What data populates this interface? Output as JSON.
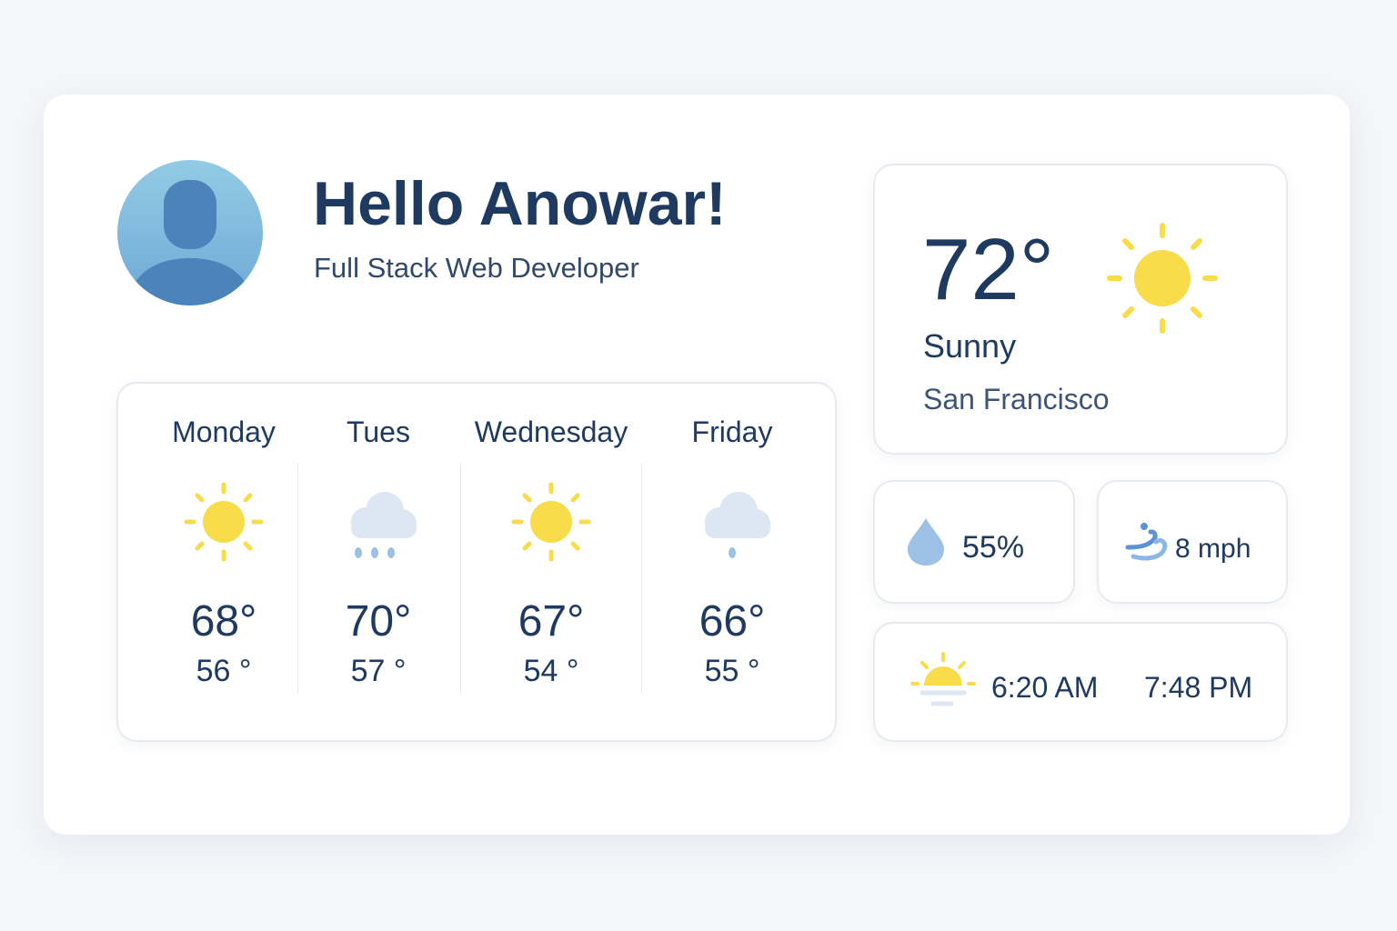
{
  "profile": {
    "greeting": "Hello Anowar!",
    "subtitle": "Full Stack Web Developer",
    "avatar_icon": "user-avatar-icon"
  },
  "current": {
    "temperature": "72°",
    "condition": "Sunny",
    "location": "San Francisco",
    "icon": "sun-icon"
  },
  "forecast": [
    {
      "day": "Monday",
      "icon": "sun-icon",
      "high": "68°",
      "low": "56 °"
    },
    {
      "day": "Tues",
      "icon": "rain-cloud-icon",
      "high": "70°",
      "low": "57 °"
    },
    {
      "day": "Wednesday",
      "icon": "sun-icon",
      "high": "67°",
      "low": "54 °"
    },
    {
      "day": "Friday",
      "icon": "drizzle-cloud-icon",
      "high": "66°",
      "low": "55 °"
    }
  ],
  "stats": {
    "humidity": {
      "value": "55%",
      "icon": "water-drop-icon"
    },
    "wind": {
      "value": "8 mph",
      "icon": "wind-icon"
    },
    "sun": {
      "sunrise": "6:20 AM",
      "sunset": "7:48 PM",
      "icon": "sunrise-icon"
    }
  },
  "colors": {
    "text": "#1f3a60",
    "sun": "#f9dc4a",
    "cloud": "#dde7f3",
    "rain": "#9cc0e6",
    "avatar": "#4a84ba"
  }
}
